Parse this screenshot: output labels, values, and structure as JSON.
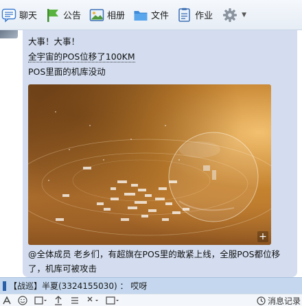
{
  "toolbar": {
    "tabs": [
      {
        "label": "聊天",
        "icon": "chat-icon"
      },
      {
        "label": "公告",
        "icon": "flag-icon"
      },
      {
        "label": "相册",
        "icon": "photo-icon"
      },
      {
        "label": "文件",
        "icon": "folder-icon"
      },
      {
        "label": "作业",
        "icon": "homework-icon"
      },
      {
        "label": "",
        "icon": "gear-icon"
      }
    ]
  },
  "message": {
    "lines": [
      "大事！大事！",
      "全宇宙的POS位移了100KM",
      "POS里面的机库没动"
    ],
    "image_expand_symbol": "+",
    "announcement": "@全体成员  老乡们，有超旗在POS里的敢紧上线，全服POS都位移了，机库可被攻击"
  },
  "notification": {
    "text": "【战巡】半夏(3324155030) ： 哎呀"
  },
  "input_toolbar": {
    "history_label": "消息记录"
  },
  "colors": {
    "bubble": "#d3ddef",
    "notification_bar": "#c4d7ee",
    "toolbar_bg": "#e6edf5",
    "accent_blue": "#2a5fa8"
  }
}
